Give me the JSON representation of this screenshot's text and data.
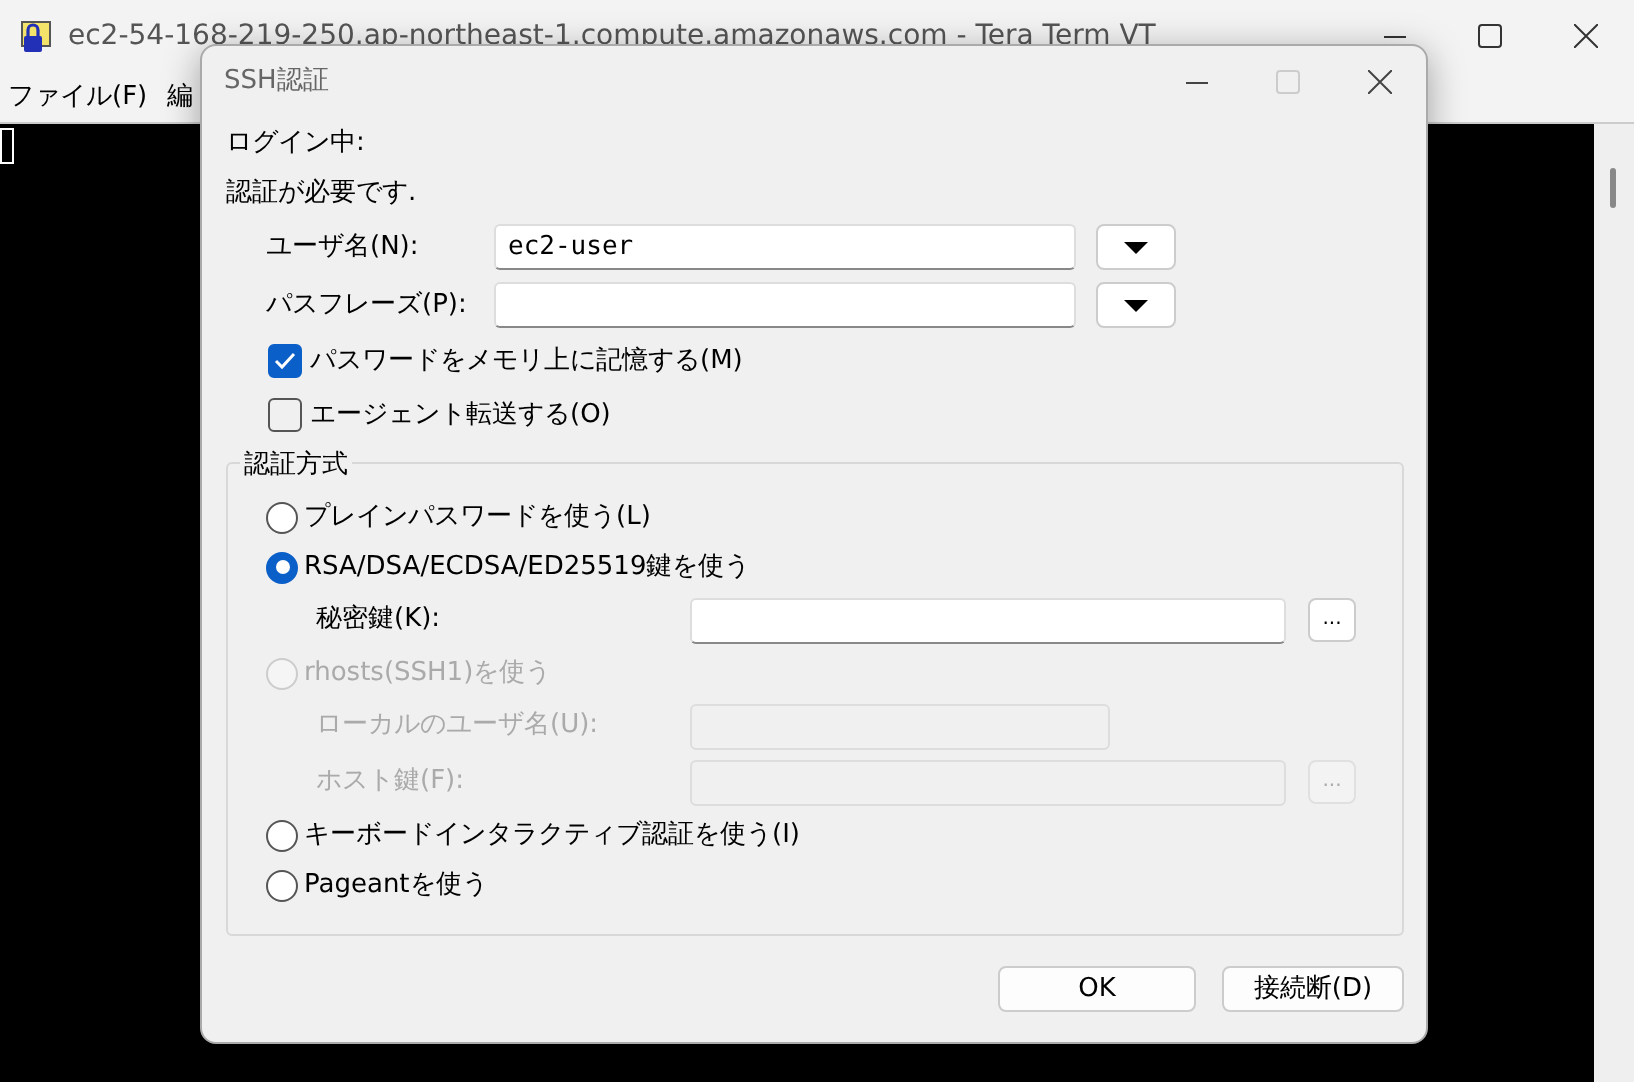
{
  "window": {
    "title": "ec2-54-168-219-250.ap-northeast-1.compute.amazonaws.com - Tera Term VT",
    "menu": [
      {
        "label": "ファイル(F)"
      },
      {
        "label": "編"
      }
    ]
  },
  "dialog": {
    "title": "SSH認証",
    "messages": [
      "ログイン中:",
      "認証が必要です."
    ],
    "fields": [
      {
        "label": "ユーザ名(N):",
        "value": "ec2-user"
      },
      {
        "label": "パスフレーズ(P):"
      }
    ],
    "checkboxes": [
      {
        "label": "パスワードをメモリ上に記憶する(M)",
        "checked": true
      },
      {
        "label": "エージェント転送する(O)",
        "checked": false
      }
    ],
    "auth_group": {
      "title": "認証方式",
      "options": [
        {
          "label": "プレインパスワードを使う(L)",
          "selected": false,
          "disabled": false
        },
        {
          "label": "RSA/DSA/ECDSA/ED25519鍵を使う",
          "selected": true,
          "disabled": false,
          "fields": [
            {
              "label": "秘密鍵(K):",
              "browse": "...",
              "disabled": false
            }
          ]
        },
        {
          "label": "rhosts(SSH1)を使う",
          "selected": false,
          "disabled": true,
          "fields": [
            {
              "label": "ローカルのユーザ名(U):",
              "disabled": true
            },
            {
              "label": "ホスト鍵(F):",
              "browse": "...",
              "disabled": true
            }
          ]
        },
        {
          "label": "キーボードインタラクティブ認証を使う(I)",
          "selected": false,
          "disabled": false
        },
        {
          "label": "Pageantを使う",
          "selected": false,
          "disabled": false
        }
      ]
    },
    "buttons": [
      {
        "label": "OK"
      },
      {
        "label": "接続断(D)"
      }
    ]
  }
}
